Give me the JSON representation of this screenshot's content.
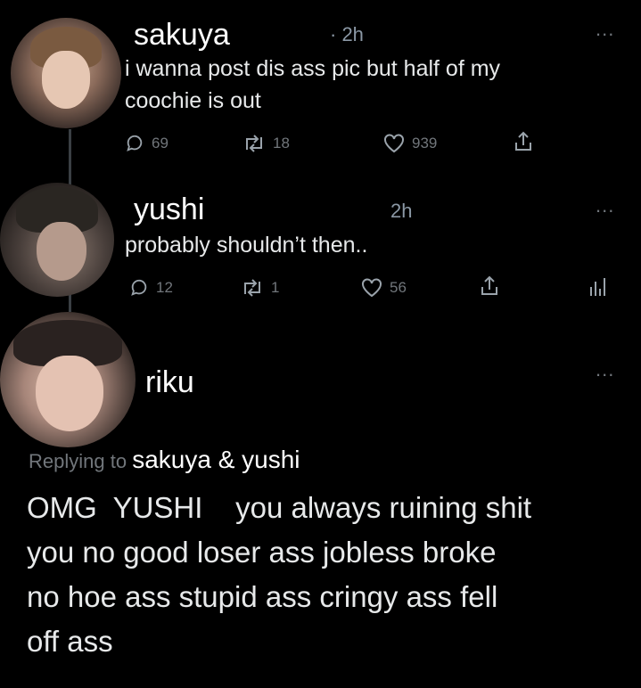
{
  "tweets": [
    {
      "name": "sakuya",
      "time": "· 2h",
      "text_lines": [
        "i wanna post dis ass pic but half of my",
        "coochie is out"
      ],
      "more": "...",
      "replies": "69",
      "retweets": "18",
      "likes": "939"
    },
    {
      "name": "yushi",
      "time": "2h",
      "text_lines": [
        "probably shouldn’t then.."
      ],
      "more": "...",
      "replies": "12",
      "retweets": "1",
      "likes": "56"
    },
    {
      "name": "riku",
      "more": "...",
      "replying_label": "Replying to",
      "replying_names": "sakuya & yushi",
      "text_lines": [
        "OMG  YUSHI    you always ruining shit",
        "you no good loser ass jobless broke",
        "no hoe ass stupid ass cringy ass fell",
        "off ass"
      ]
    }
  ],
  "icons": {
    "reply": "reply-icon",
    "retweet": "retweet-icon",
    "like": "heart-icon",
    "share": "share-icon",
    "analytics": "analytics-icon",
    "more": "more-icon"
  },
  "colors": {
    "background": "#000000",
    "muted": "#71767b",
    "text": "#e7e9ea"
  }
}
